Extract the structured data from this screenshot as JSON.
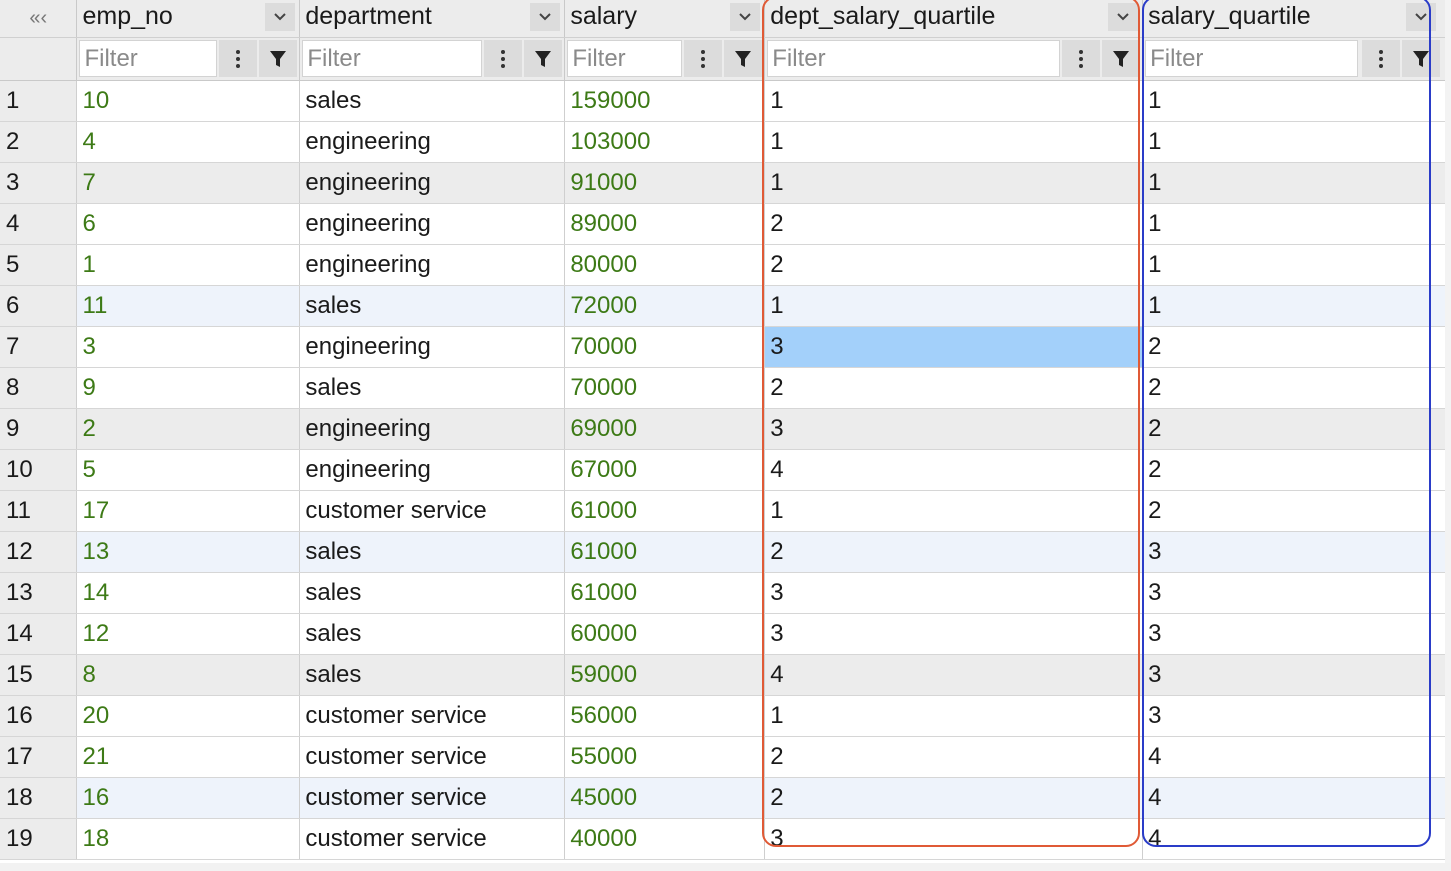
{
  "collapse_glyph": "«‹",
  "filter_placeholder": "Filter",
  "columns": [
    {
      "name": "emp_no",
      "type": "num"
    },
    {
      "name": "department",
      "type": "text"
    },
    {
      "name": "salary",
      "type": "num"
    },
    {
      "name": "dept_salary_quartile",
      "type": "text"
    },
    {
      "name": "salary_quartile",
      "type": "text"
    }
  ],
  "rows": [
    [
      "1",
      "10",
      "sales",
      "159000",
      "1",
      "1"
    ],
    [
      "2",
      "4",
      "engineering",
      "103000",
      "1",
      "1"
    ],
    [
      "3",
      "7",
      "engineering",
      "91000",
      "1",
      "1"
    ],
    [
      "4",
      "6",
      "engineering",
      "89000",
      "2",
      "1"
    ],
    [
      "5",
      "1",
      "engineering",
      "80000",
      "2",
      "1"
    ],
    [
      "6",
      "11",
      "sales",
      "72000",
      "1",
      "1"
    ],
    [
      "7",
      "3",
      "engineering",
      "70000",
      "3",
      "2"
    ],
    [
      "8",
      "9",
      "sales",
      "70000",
      "2",
      "2"
    ],
    [
      "9",
      "2",
      "engineering",
      "69000",
      "3",
      "2"
    ],
    [
      "10",
      "5",
      "engineering",
      "67000",
      "4",
      "2"
    ],
    [
      "11",
      "17",
      "customer service",
      "61000",
      "1",
      "2"
    ],
    [
      "12",
      "13",
      "sales",
      "61000",
      "2",
      "3"
    ],
    [
      "13",
      "14",
      "sales",
      "61000",
      "3",
      "3"
    ],
    [
      "14",
      "12",
      "sales",
      "60000",
      "3",
      "3"
    ],
    [
      "15",
      "8",
      "sales",
      "59000",
      "4",
      "3"
    ],
    [
      "16",
      "20",
      "customer service",
      "56000",
      "1",
      "3"
    ],
    [
      "17",
      "21",
      "customer service",
      "55000",
      "2",
      "4"
    ],
    [
      "18",
      "16",
      "customer service",
      "45000",
      "2",
      "4"
    ],
    [
      "19",
      "18",
      "customer service",
      "40000",
      "3",
      "4"
    ]
  ],
  "row_shading": [
    "",
    "",
    "alt",
    "",
    "",
    "hl",
    "",
    "",
    "alt",
    "",
    "",
    "hl",
    "",
    "",
    "alt",
    "",
    "",
    "hl",
    ""
  ],
  "selected_cell": {
    "row": 7,
    "column": "dept_salary_quartile"
  },
  "colors": {
    "numeric_text": "#3d7a16",
    "selection": "#a3d0fa",
    "outline_red": "#e05a36",
    "outline_blue": "#2a3cc8"
  }
}
